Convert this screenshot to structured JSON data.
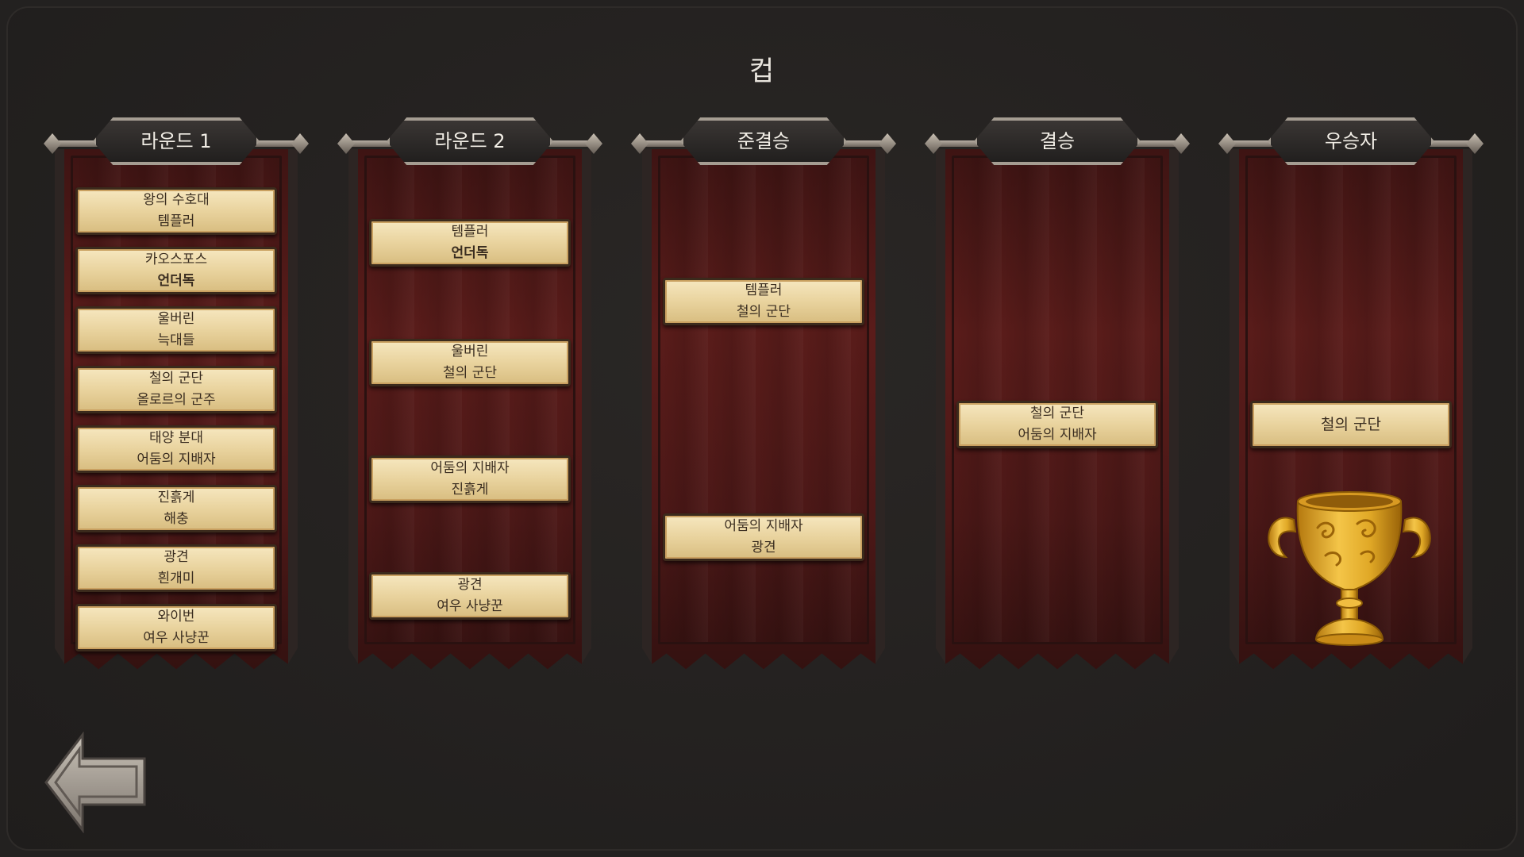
{
  "title": "컵",
  "rounds": [
    {
      "label": "라운드 1",
      "matches": [
        {
          "top": "왕의 수호대",
          "bottom": "템플러",
          "winner": "bottom"
        },
        {
          "top": "카오스포스",
          "bottom": "언더독",
          "winner": "bottom"
        },
        {
          "top": "울버린",
          "bottom": "늑대들",
          "winner": "top"
        },
        {
          "top": "철의 군단",
          "bottom": "올로르의 군주",
          "winner": "top"
        },
        {
          "top": "태양 분대",
          "bottom": "어둠의 지배자",
          "winner": "bottom"
        },
        {
          "top": "진흙게",
          "bottom": "해충",
          "winner": "top"
        },
        {
          "top": "광견",
          "bottom": "흰개미",
          "winner": "top"
        },
        {
          "top": "와이번",
          "bottom": "여우 사냥꾼",
          "winner": "bottom"
        }
      ]
    },
    {
      "label": "라운드 2",
      "matches": [
        {
          "top": "템플러",
          "bottom": "언더독",
          "winner": "bottom"
        },
        {
          "top": "울버린",
          "bottom": "철의 군단",
          "winner": "bottom"
        },
        {
          "top": "어둠의 지배자",
          "bottom": "진흙게",
          "winner": "top"
        },
        {
          "top": "광견",
          "bottom": "여우 사냥꾼",
          "winner": "top"
        }
      ]
    },
    {
      "label": "준결승",
      "matches": [
        {
          "top": "템플러",
          "bottom": "철의 군단",
          "winner": "bottom"
        },
        {
          "top": "어둠의 지배자",
          "bottom": "광견",
          "winner": "top"
        }
      ]
    },
    {
      "label": "결승",
      "matches": [
        {
          "top": "철의 군단",
          "bottom": "어둠의 지배자",
          "winner": "top"
        }
      ]
    },
    {
      "label": "우승자",
      "matches": [
        {
          "single": "철의 군단"
        }
      ]
    }
  ],
  "icons": {
    "trophy": "trophy-icon",
    "back": "back-arrow-icon"
  },
  "colors": {
    "banner": "#5a1c1a",
    "card": "#e9d39e",
    "trophy": "#e0a826",
    "background": "#232120"
  }
}
